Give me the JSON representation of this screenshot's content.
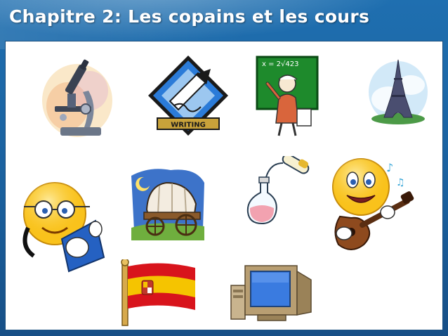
{
  "slide": {
    "title": "Chapitre 2: Les copains et les cours",
    "writing_label": "WRITING",
    "chalkboard_equation": "x = 2√423",
    "colors": {
      "background": "#1f6fb0",
      "content": "#ffffff",
      "chalkboard": "#1e8a2c",
      "writing_diamond": "#2b7bd8",
      "flag_red": "#d8141c",
      "flag_yellow": "#f5c400"
    },
    "icons": [
      "microscope-icon",
      "writing-icon",
      "teacher-chalkboard-icon",
      "eiffel-tower-icon",
      "reading-smiley-icon",
      "covered-wagon-icon",
      "flask-icon",
      "guitar-smiley-icon",
      "spain-flag-icon",
      "computer-icon"
    ]
  }
}
